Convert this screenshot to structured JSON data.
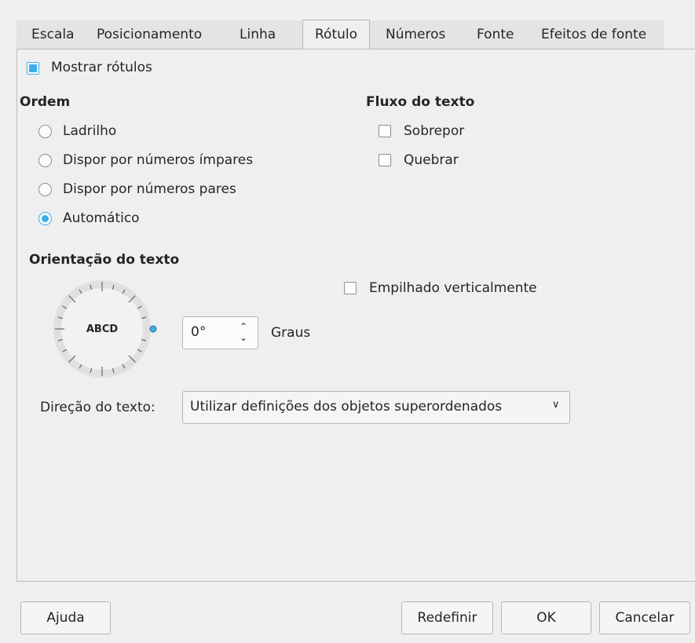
{
  "tabs": [
    {
      "label": "Escala"
    },
    {
      "label": "Posicionamento"
    },
    {
      "label": "Linha"
    },
    {
      "label": "Rótulo"
    },
    {
      "label": "Números"
    },
    {
      "label": "Fonte"
    },
    {
      "label": "Efeitos de fonte"
    }
  ],
  "show_labels": {
    "label": "Mostrar rótulos",
    "checked": true
  },
  "order": {
    "heading": "Ordem",
    "options": [
      {
        "label": "Ladrilho",
        "checked": false
      },
      {
        "label": "Dispor por números ímpares",
        "checked": false
      },
      {
        "label": "Dispor por números pares",
        "checked": false
      },
      {
        "label": "Automático",
        "checked": true
      }
    ]
  },
  "text_flow": {
    "heading": "Fluxo do texto",
    "overlap": {
      "label": "Sobrepor",
      "checked": false
    },
    "break": {
      "label": "Quebrar",
      "checked": false
    }
  },
  "orientation": {
    "heading": "Orientação do texto",
    "dial_text": "ABCD",
    "stacked": {
      "label": "Empilhado verticalmente",
      "checked": false
    },
    "degrees_value": "0°",
    "degrees_label": "Graus"
  },
  "text_direction": {
    "label": "Direção do texto:",
    "value": "Utilizar definições dos objetos superordenados"
  },
  "buttons": {
    "help": "Ajuda",
    "reset": "Redefinir",
    "ok": "OK",
    "cancel": "Cancelar"
  },
  "colors": {
    "accent": "#3daee9"
  }
}
